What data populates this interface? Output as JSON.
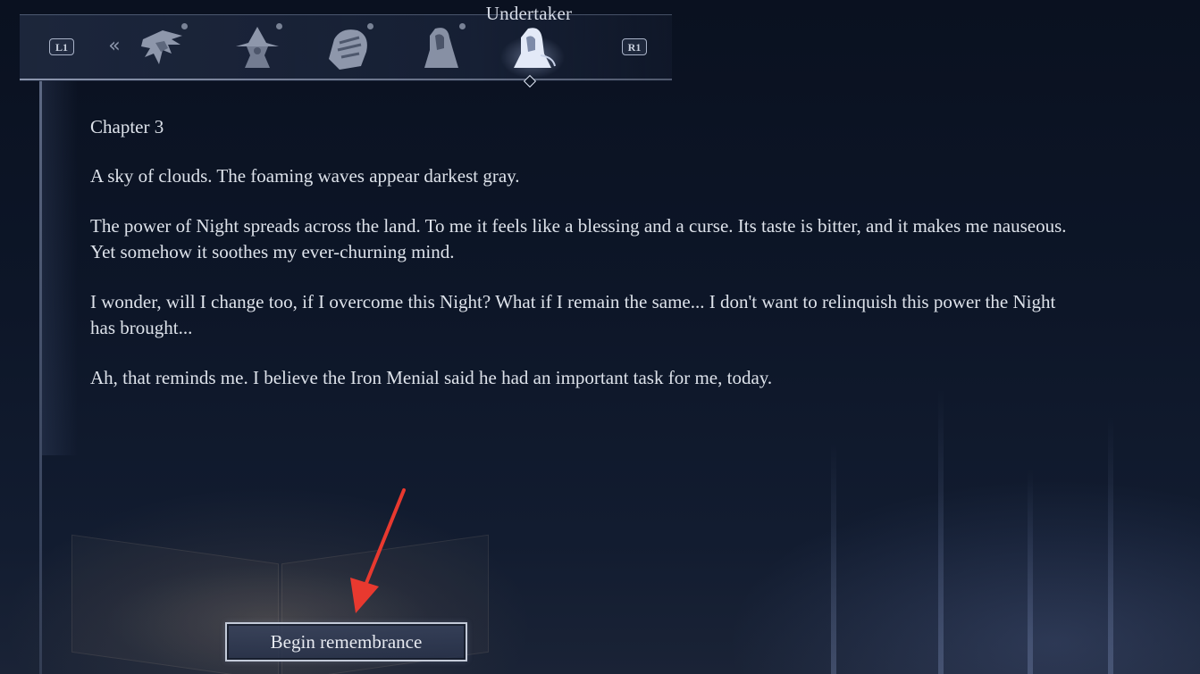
{
  "header": {
    "selected_character": "Undertaker",
    "left_shoulder_label": "L1",
    "right_shoulder_label": "R1",
    "characters": [
      {
        "icon": "wylder-portrait-icon",
        "selected": false,
        "has_notification": true
      },
      {
        "icon": "witch-hat-portrait-icon",
        "selected": false,
        "has_notification": true
      },
      {
        "icon": "hooded-warrior-portrait-icon",
        "selected": false,
        "has_notification": true
      },
      {
        "icon": "cloaked-figure-portrait-icon",
        "selected": false,
        "has_notification": true
      },
      {
        "icon": "undertaker-portrait-icon",
        "selected": true,
        "has_notification": false
      }
    ]
  },
  "journal": {
    "chapter_title": "Chapter 3",
    "paragraphs": [
      "A sky of clouds. The foaming waves appear darkest gray.",
      "The power of Night spreads across the land. To me it feels like a blessing and a curse. Its taste is bitter, and it makes me nauseous. Yet somehow it soothes my ever-churning mind.",
      "I wonder, will I change too, if I overcome this Night? What if I remain the same... I don't want to relinquish this power the Night has brought...",
      "Ah, that reminds me. I believe the Iron Menial said he had an important task for me, today."
    ]
  },
  "actions": {
    "begin_label": "Begin remembrance"
  },
  "colors": {
    "text": "#dde2ea",
    "annotation_arrow": "#e8392f",
    "background": "#0d1628"
  }
}
